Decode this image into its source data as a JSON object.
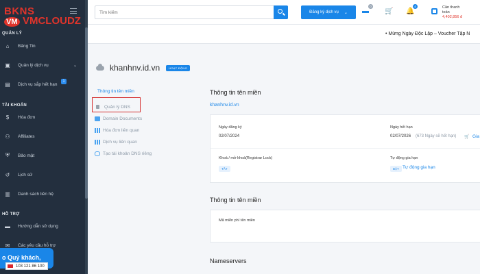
{
  "sidebar": {
    "logo_top": "BKNS",
    "watermark_vm": "VM",
    "watermark_name": "VMCLOUDZ",
    "sections": [
      {
        "label": "QUẢN LÝ"
      },
      {
        "label": "TÀI KHOẢN"
      },
      {
        "label": "HỖ TRỢ"
      }
    ],
    "items": [
      {
        "label": "Bảng Tin",
        "icon": "home-icon"
      },
      {
        "label": "Quản lý dịch vụ",
        "icon": "services-icon"
      },
      {
        "label": "Dịch vụ sắp hết hạn",
        "icon": "expiring-icon",
        "badge": "1"
      },
      {
        "label": "Hóa đơn",
        "icon": "dollar-icon"
      },
      {
        "label": "Affiliates",
        "icon": "affiliates-icon"
      },
      {
        "label": "Bảo mật",
        "icon": "shield-icon"
      },
      {
        "label": "Lịch sử",
        "icon": "history-icon"
      },
      {
        "label": "Danh sách liên hệ",
        "icon": "contacts-icon"
      },
      {
        "label": "Hướng dẫn sử dụng",
        "icon": "guide-icon"
      },
      {
        "label": "Các yêu cầu hỗ trợ",
        "icon": "support-icon"
      }
    ],
    "chat_text": "o Quý khách,",
    "phone": "103 121 86 100"
  },
  "topbar": {
    "search_placeholder": "Tìm kiếm",
    "register_label": "Đăng ký dịch vụ",
    "messages_badge": "0",
    "notifications_badge": "4",
    "wallet_label_1": "Cần thanh",
    "wallet_label_2": "toán",
    "wallet_amount": "4,402,856 đ"
  },
  "marquee": {
    "text": "• Mừng Ngày Độc Lập – Voucher Tập N"
  },
  "domain": {
    "name": "khanhnv.id.vn",
    "status": "HOẠT ĐỘNG"
  },
  "left_menu": {
    "title": "Thông tin tên miền",
    "items": [
      {
        "label": "Quản lý DNS"
      },
      {
        "label": "Domain Documents"
      },
      {
        "label": "Hóa đơn liên quan"
      },
      {
        "label": "Dịch vụ liên quan"
      },
      {
        "label": "Tạo tài khoản DNS riêng"
      }
    ]
  },
  "info": {
    "title": "Thông tin tên miền",
    "domain_link": "khanhnv.id.vn",
    "reg_date_label": "Ngày đăng ký",
    "reg_date": "02/07/2024",
    "exp_date_label": "Ngày hết hạn",
    "exp_date": "02/07/2026",
    "exp_days": "(673 Ngày sẽ hết hạn)",
    "renew_label": "Gia",
    "lock_label": "Khoá / mở khoá(Registrar Lock)",
    "lock_tag": "TẮT",
    "auto_label": "Tự động gia hạn",
    "auto_tag": "BẬT",
    "auto_link": "Tự động gia hạn"
  },
  "epp": {
    "title": "Thông tin tên miền",
    "label": "Mã miễn phí tên miền"
  },
  "nameservers": {
    "title": "Nameservers"
  }
}
